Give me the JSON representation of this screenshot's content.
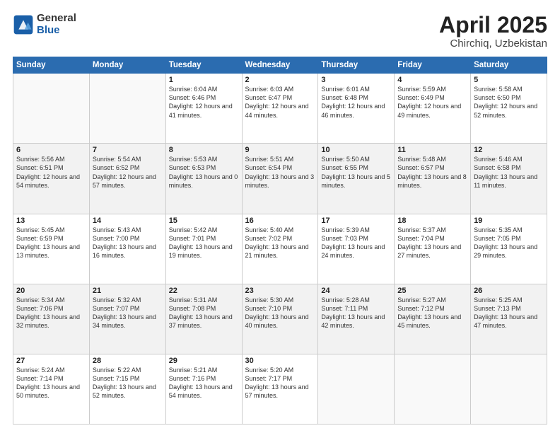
{
  "header": {
    "logo_general": "General",
    "logo_blue": "Blue",
    "month_title": "April 2025",
    "location": "Chirchiq, Uzbekistan"
  },
  "weekdays": [
    "Sunday",
    "Monday",
    "Tuesday",
    "Wednesday",
    "Thursday",
    "Friday",
    "Saturday"
  ],
  "weeks": [
    [
      {
        "day": "",
        "info": ""
      },
      {
        "day": "",
        "info": ""
      },
      {
        "day": "1",
        "info": "Sunrise: 6:04 AM\nSunset: 6:46 PM\nDaylight: 12 hours and 41 minutes."
      },
      {
        "day": "2",
        "info": "Sunrise: 6:03 AM\nSunset: 6:47 PM\nDaylight: 12 hours and 44 minutes."
      },
      {
        "day": "3",
        "info": "Sunrise: 6:01 AM\nSunset: 6:48 PM\nDaylight: 12 hours and 46 minutes."
      },
      {
        "day": "4",
        "info": "Sunrise: 5:59 AM\nSunset: 6:49 PM\nDaylight: 12 hours and 49 minutes."
      },
      {
        "day": "5",
        "info": "Sunrise: 5:58 AM\nSunset: 6:50 PM\nDaylight: 12 hours and 52 minutes."
      }
    ],
    [
      {
        "day": "6",
        "info": "Sunrise: 5:56 AM\nSunset: 6:51 PM\nDaylight: 12 hours and 54 minutes."
      },
      {
        "day": "7",
        "info": "Sunrise: 5:54 AM\nSunset: 6:52 PM\nDaylight: 12 hours and 57 minutes."
      },
      {
        "day": "8",
        "info": "Sunrise: 5:53 AM\nSunset: 6:53 PM\nDaylight: 13 hours and 0 minutes."
      },
      {
        "day": "9",
        "info": "Sunrise: 5:51 AM\nSunset: 6:54 PM\nDaylight: 13 hours and 3 minutes."
      },
      {
        "day": "10",
        "info": "Sunrise: 5:50 AM\nSunset: 6:55 PM\nDaylight: 13 hours and 5 minutes."
      },
      {
        "day": "11",
        "info": "Sunrise: 5:48 AM\nSunset: 6:57 PM\nDaylight: 13 hours and 8 minutes."
      },
      {
        "day": "12",
        "info": "Sunrise: 5:46 AM\nSunset: 6:58 PM\nDaylight: 13 hours and 11 minutes."
      }
    ],
    [
      {
        "day": "13",
        "info": "Sunrise: 5:45 AM\nSunset: 6:59 PM\nDaylight: 13 hours and 13 minutes."
      },
      {
        "day": "14",
        "info": "Sunrise: 5:43 AM\nSunset: 7:00 PM\nDaylight: 13 hours and 16 minutes."
      },
      {
        "day": "15",
        "info": "Sunrise: 5:42 AM\nSunset: 7:01 PM\nDaylight: 13 hours and 19 minutes."
      },
      {
        "day": "16",
        "info": "Sunrise: 5:40 AM\nSunset: 7:02 PM\nDaylight: 13 hours and 21 minutes."
      },
      {
        "day": "17",
        "info": "Sunrise: 5:39 AM\nSunset: 7:03 PM\nDaylight: 13 hours and 24 minutes."
      },
      {
        "day": "18",
        "info": "Sunrise: 5:37 AM\nSunset: 7:04 PM\nDaylight: 13 hours and 27 minutes."
      },
      {
        "day": "19",
        "info": "Sunrise: 5:35 AM\nSunset: 7:05 PM\nDaylight: 13 hours and 29 minutes."
      }
    ],
    [
      {
        "day": "20",
        "info": "Sunrise: 5:34 AM\nSunset: 7:06 PM\nDaylight: 13 hours and 32 minutes."
      },
      {
        "day": "21",
        "info": "Sunrise: 5:32 AM\nSunset: 7:07 PM\nDaylight: 13 hours and 34 minutes."
      },
      {
        "day": "22",
        "info": "Sunrise: 5:31 AM\nSunset: 7:08 PM\nDaylight: 13 hours and 37 minutes."
      },
      {
        "day": "23",
        "info": "Sunrise: 5:30 AM\nSunset: 7:10 PM\nDaylight: 13 hours and 40 minutes."
      },
      {
        "day": "24",
        "info": "Sunrise: 5:28 AM\nSunset: 7:11 PM\nDaylight: 13 hours and 42 minutes."
      },
      {
        "day": "25",
        "info": "Sunrise: 5:27 AM\nSunset: 7:12 PM\nDaylight: 13 hours and 45 minutes."
      },
      {
        "day": "26",
        "info": "Sunrise: 5:25 AM\nSunset: 7:13 PM\nDaylight: 13 hours and 47 minutes."
      }
    ],
    [
      {
        "day": "27",
        "info": "Sunrise: 5:24 AM\nSunset: 7:14 PM\nDaylight: 13 hours and 50 minutes."
      },
      {
        "day": "28",
        "info": "Sunrise: 5:22 AM\nSunset: 7:15 PM\nDaylight: 13 hours and 52 minutes."
      },
      {
        "day": "29",
        "info": "Sunrise: 5:21 AM\nSunset: 7:16 PM\nDaylight: 13 hours and 54 minutes."
      },
      {
        "day": "30",
        "info": "Sunrise: 5:20 AM\nSunset: 7:17 PM\nDaylight: 13 hours and 57 minutes."
      },
      {
        "day": "",
        "info": ""
      },
      {
        "day": "",
        "info": ""
      },
      {
        "day": "",
        "info": ""
      }
    ]
  ]
}
